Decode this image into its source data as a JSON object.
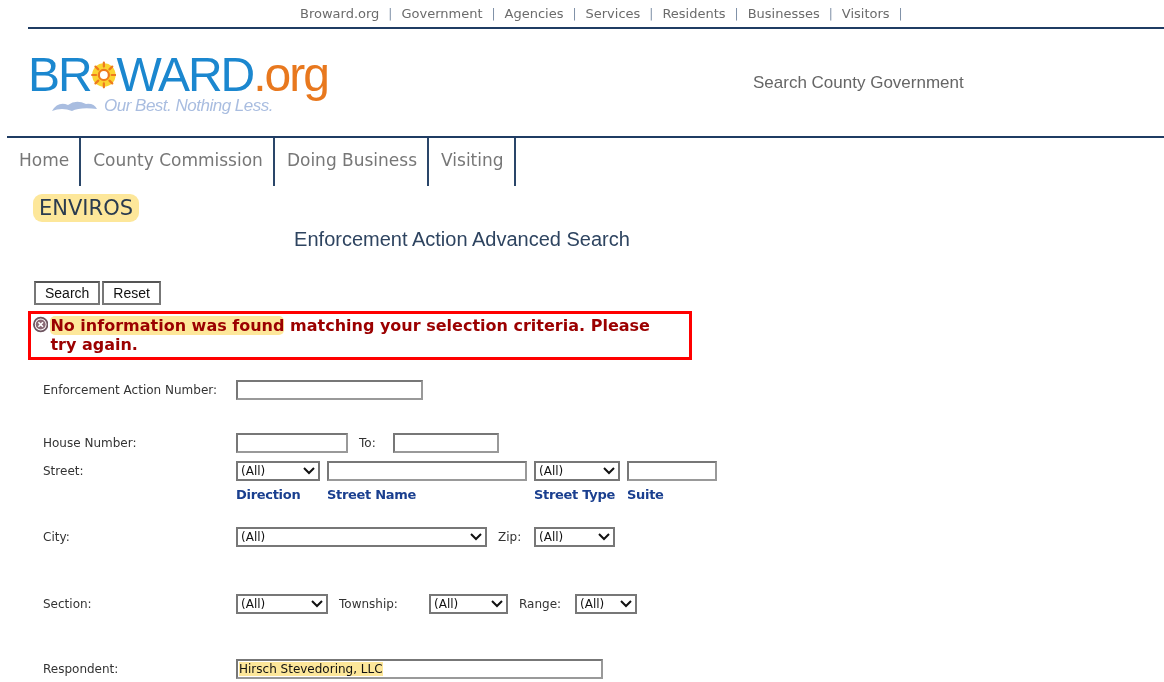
{
  "top_links": [
    {
      "label": "Broward.org"
    },
    {
      "label": "Government"
    },
    {
      "label": "Agencies"
    },
    {
      "label": "Services"
    },
    {
      "label": "Residents"
    },
    {
      "label": "Businesses"
    },
    {
      "label": "Visitors"
    }
  ],
  "top_separator": "|",
  "logo": {
    "wordmark": [
      {
        "kind": "text",
        "text": "BR",
        "color": "#1b87cf"
      },
      {
        "kind": "sun"
      },
      {
        "kind": "text",
        "text": "WARD",
        "color": "#1b87cf"
      },
      {
        "kind": "text",
        "text": ".org",
        "color": "#e8781e"
      }
    ],
    "tagline": "Our Best. Nothing Less."
  },
  "search_link": "Search County Government",
  "nav": [
    {
      "label": "Home"
    },
    {
      "label": "County Commission"
    },
    {
      "label": "Doing Business"
    },
    {
      "label": "Visiting"
    }
  ],
  "section_title": {
    "text": "ENVIROS",
    "highlighted": true
  },
  "page_title": "Enforcement Action Advanced Search",
  "buttons": [
    "Search",
    "Reset"
  ],
  "error": {
    "parts": [
      {
        "text": "No information was found",
        "highlighted": true
      },
      {
        "text": " matching your selection criteria. Please try again.",
        "highlighted": false
      }
    ]
  },
  "form": [
    {
      "label": "Enforcement Action Number:",
      "controls": [
        {
          "kind": "field"
        }
      ]
    },
    {
      "label": "House Number:",
      "controls": [
        {
          "kind": "field"
        },
        {
          "kind": "label",
          "text": "To:"
        },
        {
          "kind": "field"
        }
      ]
    },
    {
      "label": "Street:",
      "controls": [
        {
          "kind": "select",
          "value": "(All)",
          "caption": "Direction"
        },
        {
          "kind": "field",
          "caption": "Street Name"
        },
        {
          "kind": "select",
          "value": "(All)",
          "caption": "Street Type"
        },
        {
          "kind": "field",
          "caption": "Suite"
        }
      ]
    },
    {
      "label": "City:",
      "controls": [
        {
          "kind": "select",
          "value": "(All)"
        },
        {
          "kind": "label",
          "text": "Zip:"
        },
        {
          "kind": "select",
          "value": "(All)"
        }
      ]
    },
    {
      "label": "Section:",
      "controls": [
        {
          "kind": "select",
          "value": "(All)"
        },
        {
          "kind": "label",
          "text": "Township:"
        },
        {
          "kind": "select",
          "value": "(All)"
        },
        {
          "kind": "label",
          "text": "Range:"
        },
        {
          "kind": "select",
          "value": "(All)"
        }
      ]
    },
    {
      "label": "Respondent:",
      "controls": [
        {
          "kind": "field",
          "value": "Hirsch Stevedoring, LLC",
          "highlighted": true
        }
      ]
    }
  ]
}
